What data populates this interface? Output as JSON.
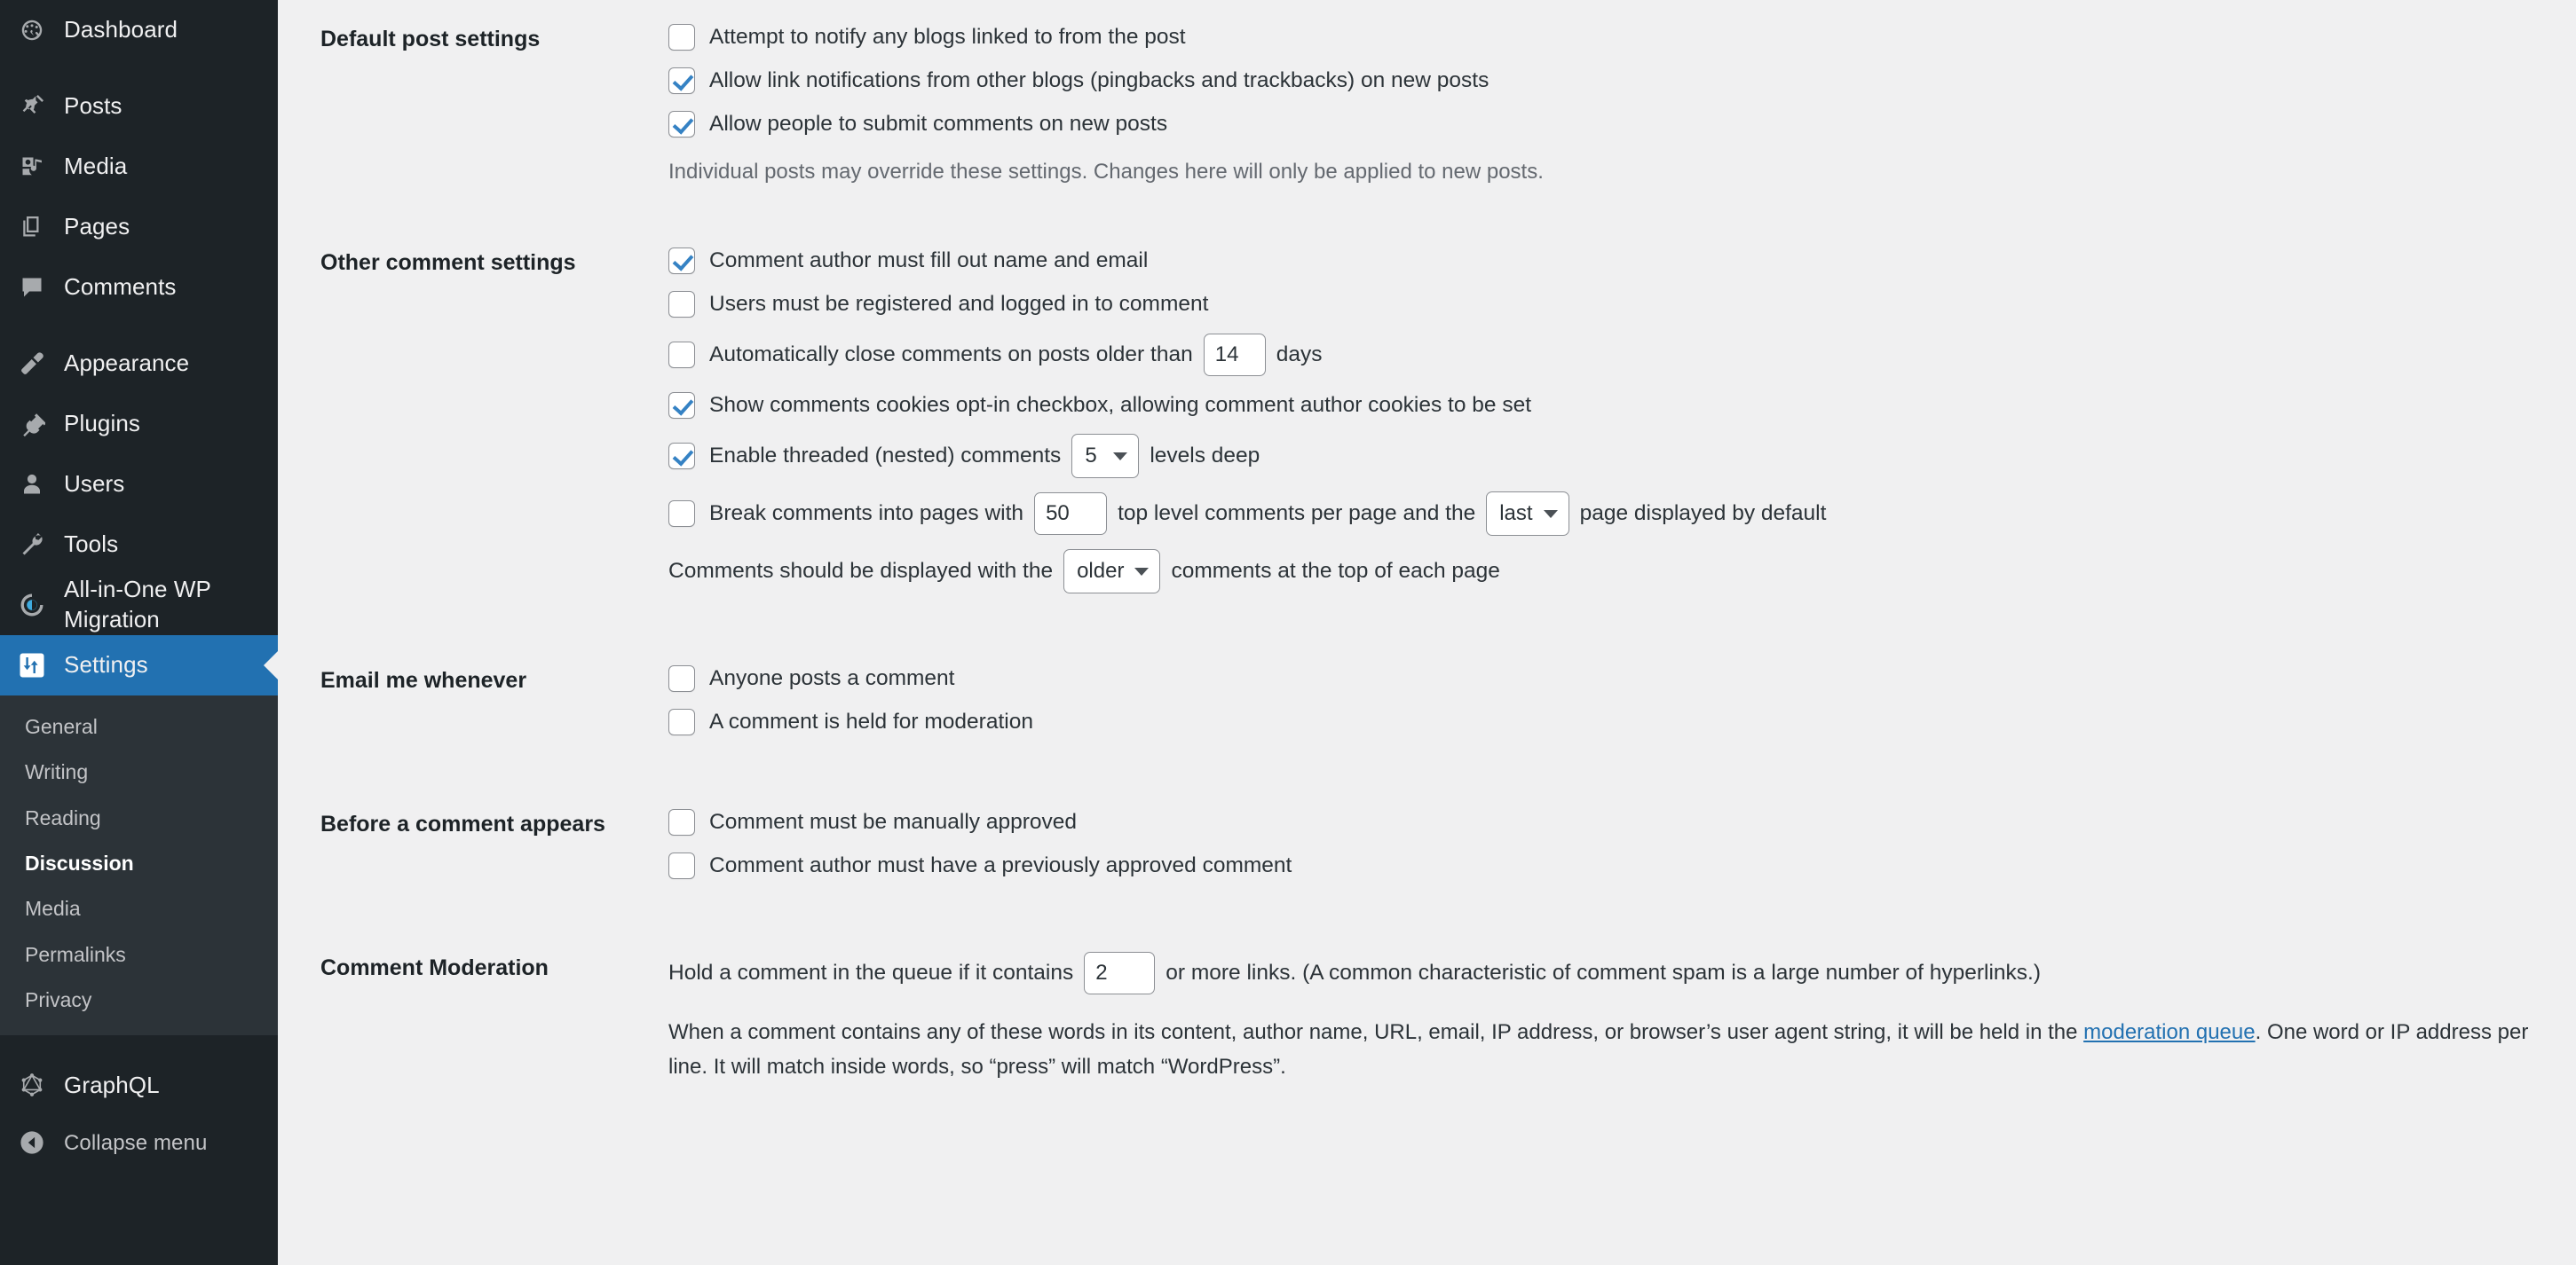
{
  "sidebar": {
    "items": [
      {
        "label": "Dashboard",
        "icon": "dashboard-icon"
      },
      {
        "label": "Posts",
        "icon": "pin-icon"
      },
      {
        "label": "Media",
        "icon": "media-icon"
      },
      {
        "label": "Pages",
        "icon": "pages-icon"
      },
      {
        "label": "Comments",
        "icon": "comment-bubble-icon"
      },
      {
        "label": "Appearance",
        "icon": "paintbrush-icon"
      },
      {
        "label": "Plugins",
        "icon": "plug-icon"
      },
      {
        "label": "Users",
        "icon": "user-icon"
      },
      {
        "label": "Tools",
        "icon": "wrench-icon"
      },
      {
        "label": "All-in-One WP Migration",
        "icon": "migration-circle-icon"
      }
    ],
    "settings": {
      "label": "Settings",
      "icon": "sliders-icon"
    },
    "submenu": [
      {
        "label": "General",
        "active": false
      },
      {
        "label": "Writing",
        "active": false
      },
      {
        "label": "Reading",
        "active": false
      },
      {
        "label": "Discussion",
        "active": true
      },
      {
        "label": "Media",
        "active": false
      },
      {
        "label": "Permalinks",
        "active": false
      },
      {
        "label": "Privacy",
        "active": false
      }
    ],
    "graphql": {
      "label": "GraphQL",
      "icon": "graphql-icon"
    },
    "collapse": {
      "label": "Collapse menu",
      "icon": "collapse-arrow-icon"
    },
    "colors": {
      "bg": "#1d2327",
      "submenu_bg": "#2c3338",
      "active_blue": "#2271b1",
      "text": "#f0f0f1",
      "muted_text": "#c3c4c7"
    }
  },
  "main": {
    "colors": {
      "bg": "#f0f0f1",
      "text": "#1d2327",
      "link": "#2271b1",
      "check": "#3582c4"
    },
    "default_post_settings": {
      "heading": "Default post settings",
      "options": [
        {
          "label": "Attempt to notify any blogs linked to from the post",
          "checked": false
        },
        {
          "label": "Allow link notifications from other blogs (pingbacks and trackbacks) on new posts",
          "checked": true
        },
        {
          "label": "Allow people to submit comments on new posts",
          "checked": true
        }
      ],
      "helper": "Individual posts may override these settings. Changes here will only be applied to new posts."
    },
    "other_comment_settings": {
      "heading": "Other comment settings",
      "option_author_name_email": {
        "label": "Comment author must fill out name and email",
        "checked": true
      },
      "option_registered": {
        "label": "Users must be registered and logged in to comment",
        "checked": false
      },
      "option_auto_close": {
        "label_before": "Automatically close comments on posts older than",
        "value": "14",
        "label_after": "days",
        "checked": false
      },
      "option_cookies": {
        "label": "Show comments cookies opt-in checkbox, allowing comment author cookies to be set",
        "checked": true
      },
      "option_threaded": {
        "label_before": "Enable threaded (nested) comments",
        "value": "5",
        "label_after": "levels deep",
        "checked": true
      },
      "option_paged": {
        "label_before": "Break comments into pages with",
        "value": "50",
        "label_middle": "top level comments per page and the",
        "page_default": "last",
        "label_after": "page displayed by default",
        "checked": false
      },
      "display_order": {
        "label_before": "Comments should be displayed with the",
        "value": "older",
        "label_after": "comments at the top of each page"
      }
    },
    "email_me_whenever": {
      "heading": "Email me whenever",
      "options": [
        {
          "label": "Anyone posts a comment",
          "checked": false
        },
        {
          "label": "A comment is held for moderation",
          "checked": false
        }
      ]
    },
    "before_comment_appears": {
      "heading": "Before a comment appears",
      "options": [
        {
          "label": "Comment must be manually approved",
          "checked": false
        },
        {
          "label": "Comment author must have a previously approved comment",
          "checked": false
        }
      ]
    },
    "comment_moderation": {
      "heading": "Comment Moderation",
      "hold_before": "Hold a comment in the queue if it contains",
      "hold_value": "2",
      "hold_after": "or more links. (A common characteristic of comment spam is a large number of hyperlinks.)",
      "para_before": "When a comment contains any of these words in its content, author name, URL, email, IP address, or browser’s user agent string, it will be held in the ",
      "para_link": "moderation queue",
      "para_after": ". One word or IP address per line. It will match inside words, so “press” will match “WordPress”."
    }
  }
}
